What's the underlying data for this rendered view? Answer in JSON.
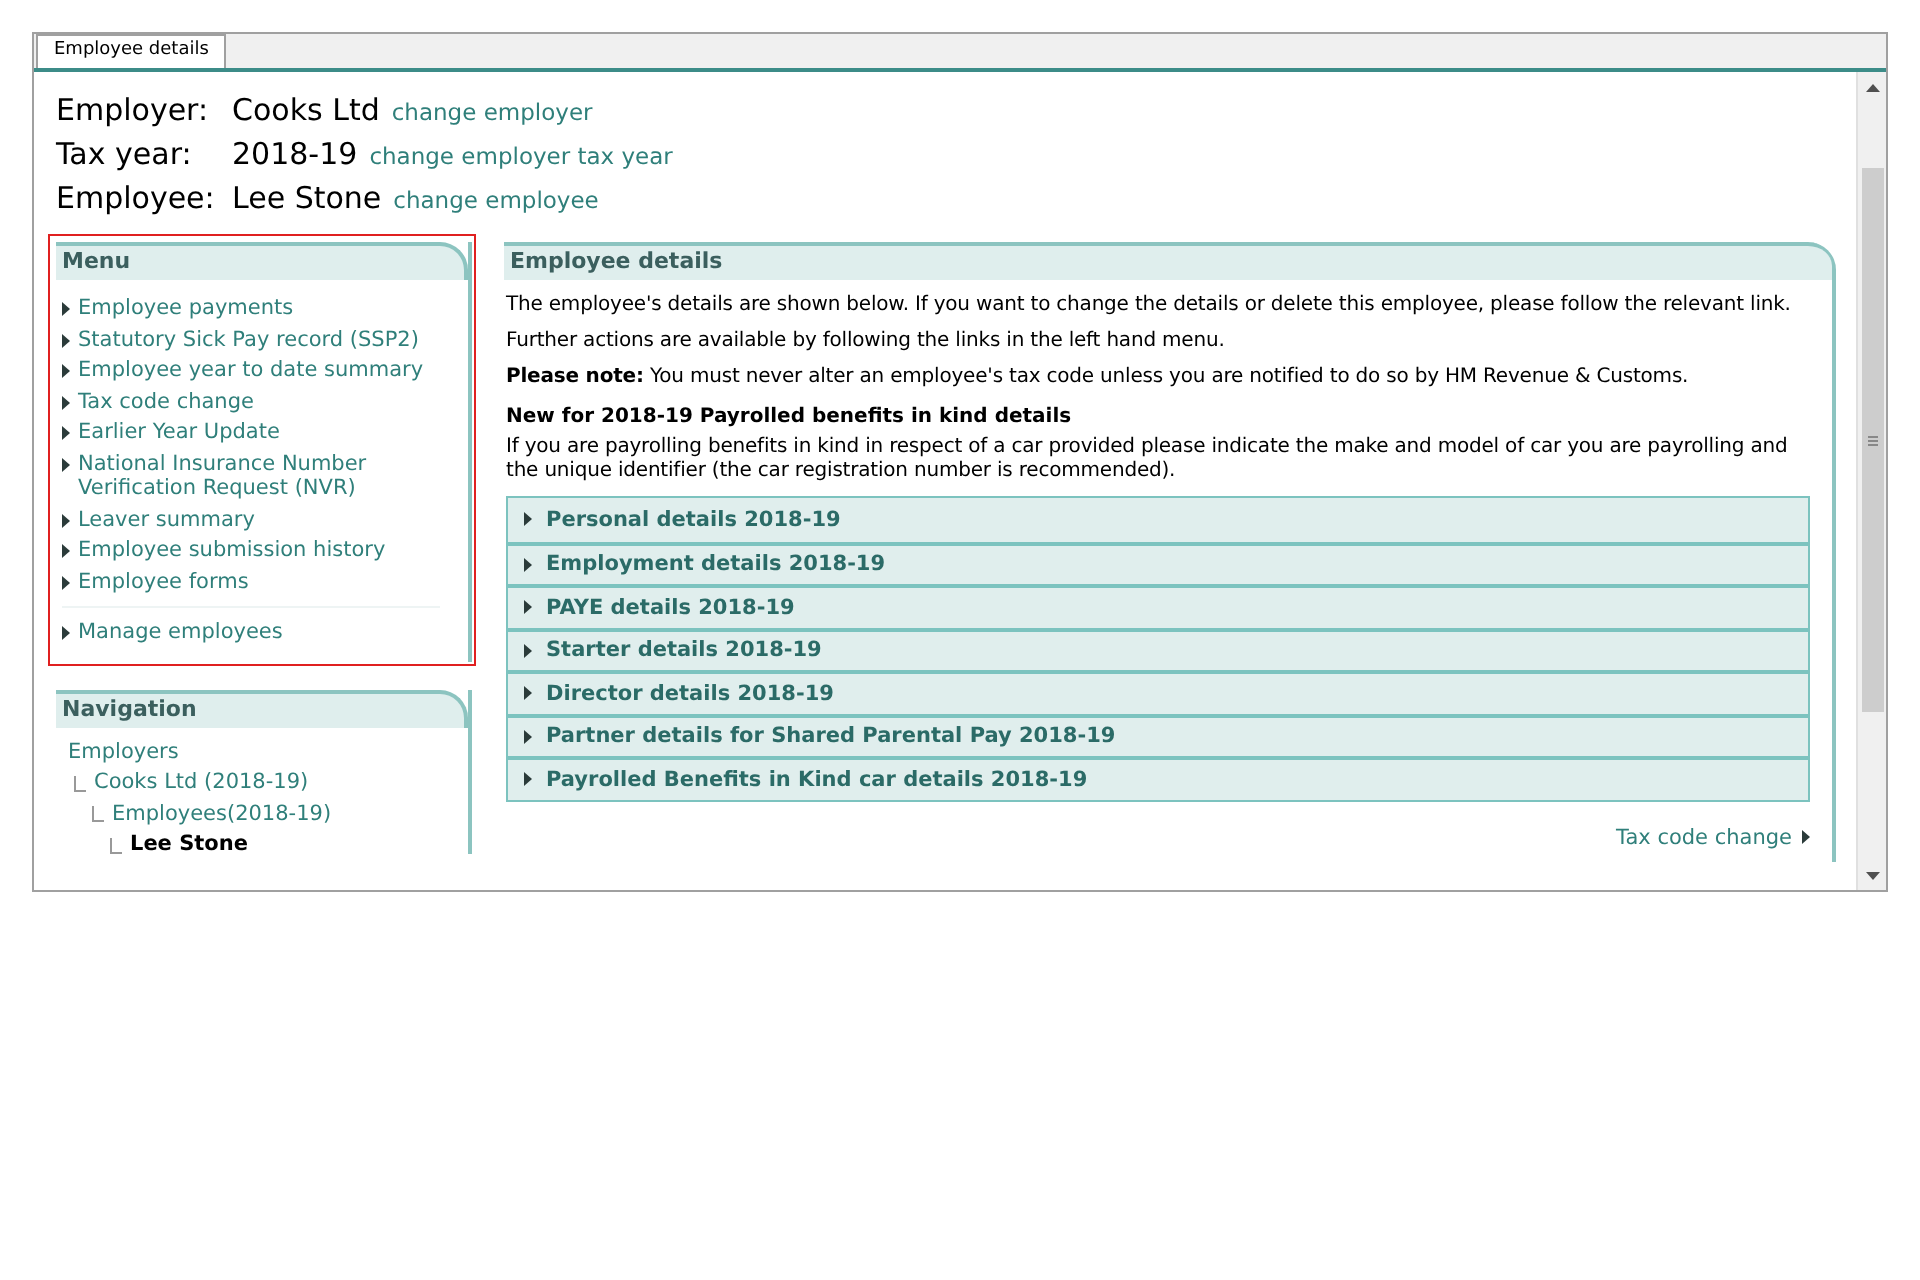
{
  "tabs": [
    {
      "label": "Employee details",
      "selected": true
    }
  ],
  "header": [
    {
      "label": "Employer:",
      "value": "Cooks Ltd",
      "link": "change employer"
    },
    {
      "label": "Tax year:",
      "value": "2018-19",
      "link": "change employer tax year"
    },
    {
      "label": "Employee:",
      "value": "Lee Stone",
      "link": "change employee"
    }
  ],
  "menu": {
    "title": "Menu",
    "highlighted": true,
    "items": [
      "Employee payments",
      "Statutory Sick Pay record (SSP2)",
      "Employee year to date summary",
      "Tax code change",
      "Earlier Year Update",
      "National Insurance Number Verification Request (NVR)",
      "Leaver summary",
      "Employee submission history",
      "Employee forms"
    ],
    "footer_item": "Manage employees"
  },
  "navigation": {
    "title": "Navigation",
    "tree": [
      {
        "label": "Employers",
        "current": false,
        "children": [
          {
            "label": "Cooks Ltd (2018-19)",
            "current": false,
            "children": [
              {
                "label": "Employees(2018-19)",
                "current": false,
                "children": [
                  {
                    "label": "Lee Stone",
                    "current": true
                  }
                ]
              }
            ]
          }
        ]
      }
    ]
  },
  "details": {
    "title": "Employee details",
    "paragraphs": [
      "The employee's details are shown below. If you want to change the details or delete this employee, please follow the relevant link.",
      "Further actions are available by following the links in the left hand menu.",
      "**Please note:** You must never alter an employee's tax code unless you are notified to do so by HM Revenue & Customs."
    ],
    "subheading": "New for 2018-19 Payrolled benefits in kind details",
    "subtext": "If you are payrolling benefits in kind in respect of a car provided please indicate the make and model of car you are payrolling and the unique identifier (the car registration number is recommended).",
    "sections": [
      {
        "label": "Personal details 2018-19",
        "expanded": false
      },
      {
        "label": "Employment details 2018-19",
        "expanded": false
      },
      {
        "label": "PAYE details 2018-19",
        "expanded": false
      },
      {
        "label": "Starter details 2018-19",
        "expanded": false
      },
      {
        "label": "Director details 2018-19",
        "expanded": false
      },
      {
        "label": "Partner details for Shared Parental Pay 2018-19",
        "expanded": false
      },
      {
        "label": "Payrolled Benefits in Kind car details 2018-19",
        "expanded": false
      }
    ],
    "next_link": "Tax code change"
  }
}
